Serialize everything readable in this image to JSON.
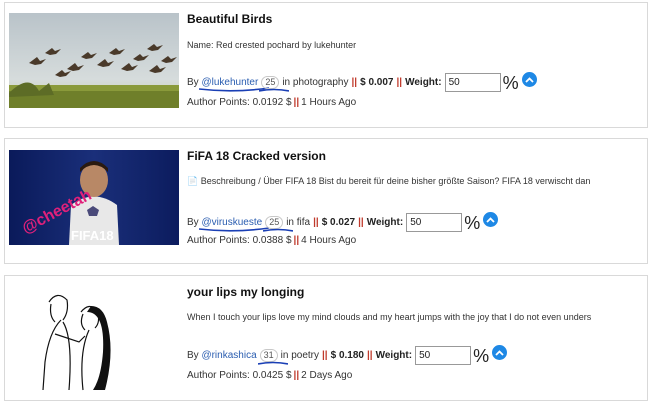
{
  "posts": [
    {
      "title": "Beautiful Birds",
      "description": "Name: Red crested pochard by lukehunter",
      "by_label": "By",
      "author": "@lukehunter",
      "reputation": "25",
      "in_label": "in photography",
      "separator": "||",
      "payout": "$ 0.007",
      "weight_label": "Weight:",
      "weight_value": "50",
      "percent": "%",
      "author_points_label": "Author Points:",
      "author_points": "0.0192 $",
      "time_ago": "1 Hours Ago",
      "thumb_icon": "flying-birds-photo"
    },
    {
      "title": "FiFA 18 Cracked version",
      "description": "📄 Beschreibung / Über FIFA 18 Bist du bereit für deine bisher größte Saison? FIFA 18 verwischt dan",
      "by_label": "By",
      "author": "@viruskueste",
      "reputation": "25",
      "in_label": "in fifa",
      "separator": "||",
      "payout": "$ 0.027",
      "weight_label": "Weight:",
      "weight_value": "50",
      "percent": "%",
      "author_points_label": "Author Points:",
      "author_points": "0.0388 $",
      "time_ago": "4 Hours Ago",
      "thumb_text_1": "@cheetah",
      "thumb_text_2": "FIFA18",
      "thumb_icon": "fifa-cover-image"
    },
    {
      "title": "your lips my longing",
      "description": "When I touch your lips love my mind clouds and my heart jumps with the joy that I do not even unders",
      "by_label": "By",
      "author": "@rinkashica",
      "reputation": "31",
      "in_label": "in poetry",
      "separator": "||",
      "payout": "$ 0.180",
      "weight_label": "Weight:",
      "weight_value": "50",
      "percent": "%",
      "author_points_label": "Author Points:",
      "author_points": "0.0425 $",
      "time_ago": "2 Days Ago",
      "thumb_icon": "couple-sketch-image"
    }
  ],
  "colors": {
    "accent": "#1e88e5",
    "separator": "#c0392b",
    "link": "#2a5db0",
    "underline": "#1a3fb5"
  }
}
